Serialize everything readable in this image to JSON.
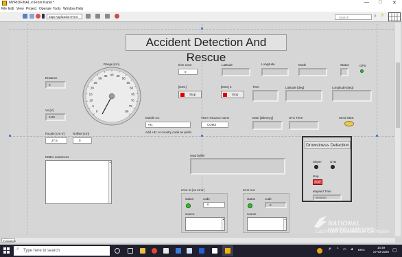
{
  "window": {
    "title": "MYRIOFINAL.vi Front Panel *",
    "controls": {
      "minimize": "—",
      "maximize": "□",
      "close": "✕"
    }
  },
  "menu": [
    "File",
    "Edit",
    "View",
    "Project",
    "Operate",
    "Tools",
    "Window",
    "Help"
  ],
  "toolbar": {
    "font": "15pt Application Font",
    "search_placeholder": "Search"
  },
  "panel": {
    "heading": "Accident Detection And Rescue",
    "distance": {
      "label": "Distance",
      "value": "0"
    },
    "vo": {
      "label": "Vo [V]",
      "value": "0.00"
    },
    "range_gauge": {
      "label": "Range [cm]",
      "ticks": [
        "0",
        "5",
        "10",
        "15",
        "20",
        "25",
        "30",
        "35",
        "40",
        "45",
        "50",
        "55",
        "60",
        "65",
        "70",
        "75",
        "80"
      ]
    },
    "rscale": {
      "label": "Rscale [cm-V]",
      "value": "27.5"
    },
    "roffset": {
      "label": "Roffset [cm]",
      "value": "0"
    },
    "nmea": {
      "label": "NMEA sentences"
    },
    "time_zone": {
      "label": "time zone",
      "value": "0"
    },
    "latitude": {
      "label": "Latitude"
    },
    "longitude": {
      "label": "Longitude"
    },
    "mode": {
      "label": "Mode"
    },
    "status": {
      "label": "Status",
      "gps": "GPS"
    },
    "esc1": {
      "label": "[ESC]",
      "button": "Stop"
    },
    "esc2": {
      "label": "[ESC] 2",
      "button": "Stop"
    },
    "time": {
      "label": "Time"
    },
    "latitude_deg": {
      "label": "Latitude [deg]"
    },
    "longitude_deg": {
      "label": "Longitude [deg]"
    },
    "mobile": {
      "label": "Mobile no:",
      "value": "+91",
      "hint": "Add +91 or country code as prefix"
    },
    "visa": {
      "label": "VISA resource name",
      "value": "COM3"
    },
    "date": {
      "label": "Date [ddmmyy]"
    },
    "utc": {
      "label": "UTC Time"
    },
    "send_sms": {
      "label": "Send SMS"
    },
    "read_buffer": {
      "label": "read buffer"
    },
    "error_in": {
      "label": "error in (no error)",
      "status": "status",
      "code": "code",
      "code_value": "0",
      "source": "source"
    },
    "error_out": {
      "label": "error out",
      "status": "status",
      "code": "code",
      "code_value": "0",
      "source": "source"
    },
    "drowsiness": {
      "title": "Drowsiness Detection",
      "slept": "Slept?",
      "utd": "UTD",
      "stop_label": "stop",
      "stop_button": "STOP",
      "elapsed_label": "elapsed Time",
      "elapsed_value": "00:00:00"
    },
    "watermark": {
      "line1": "NATIONAL INSTRUMENTS",
      "line2": "LabVIEW Evaluation Software"
    },
    "eval_tab": "Evaluation"
  },
  "taskbar": {
    "search_placeholder": "Type here to search",
    "time": "16:49",
    "date": "27-03-2020",
    "lang": "ENG"
  }
}
